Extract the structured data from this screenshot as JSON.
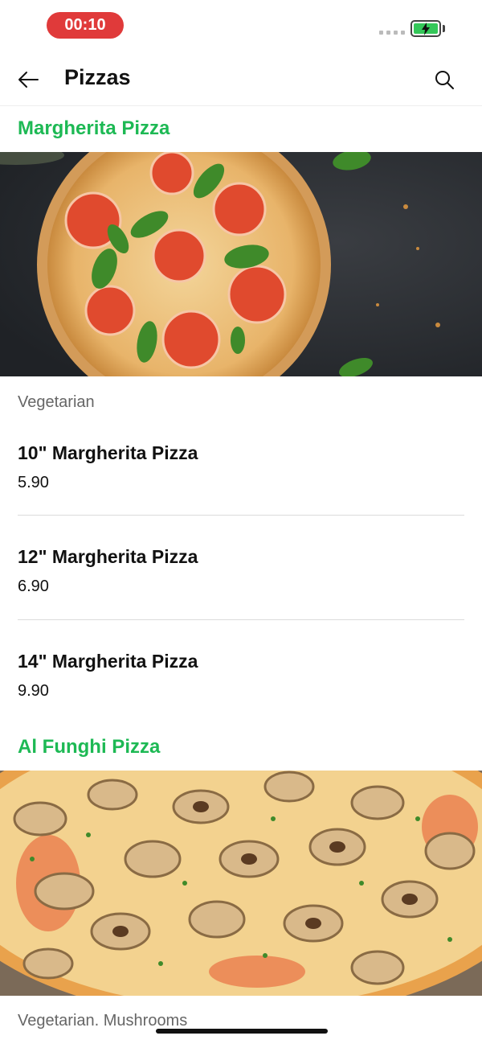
{
  "status": {
    "time": "00:10"
  },
  "appbar": {
    "title": "Pizzas",
    "back_icon": "arrow-left-icon",
    "search_icon": "search-icon"
  },
  "sections": [
    {
      "title": "Margherita Pizza",
      "description": "Vegetarian",
      "items": [
        {
          "name": "10\" Margherita Pizza",
          "price": "5.90"
        },
        {
          "name": "12\" Margherita Pizza",
          "price": "6.90"
        },
        {
          "name": "14\" Margherita Pizza",
          "price": "9.90"
        }
      ]
    },
    {
      "title": "Al Funghi Pizza",
      "description": "Vegetarian. Mushrooms",
      "items": []
    }
  ],
  "colors": {
    "accent": "#1db954",
    "time_pill": "#e03a3a",
    "battery": "#34c759"
  }
}
